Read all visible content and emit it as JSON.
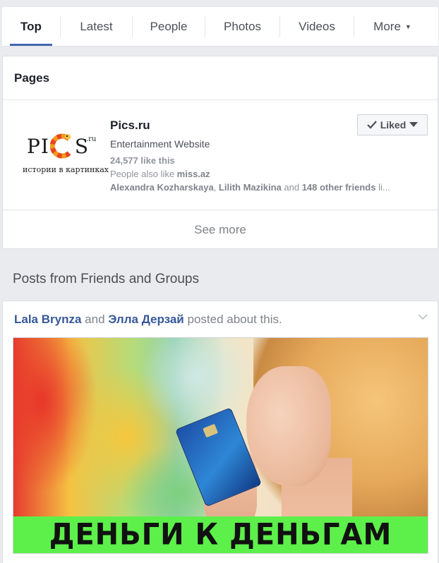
{
  "tabs": [
    {
      "label": "Top",
      "active": true
    },
    {
      "label": "Latest",
      "active": false
    },
    {
      "label": "People",
      "active": false
    },
    {
      "label": "Photos",
      "active": false
    },
    {
      "label": "Videos",
      "active": false
    },
    {
      "label": "More",
      "active": false
    }
  ],
  "pages_section": {
    "header": "Pages",
    "page": {
      "logo_text": "PICS",
      "logo_domain": ".ru",
      "logo_tagline": "истории в картинках",
      "name": "Pics.ru",
      "category": "Entertainment Website",
      "likes": "24,577 like this",
      "also_like_prefix": "People also like ",
      "also_like_page": "miss.az",
      "friend_1": "Alexandra Kozharskaya",
      "sep_1": ", ",
      "friend_2": "Lilith Mazikina",
      "sep_2": " and ",
      "friends_other": "148 other friends",
      "friends_suffix": " li...",
      "liked_button": "Liked"
    },
    "see_more": "See more"
  },
  "posts_section_title": "Posts from Friends and Groups",
  "post": {
    "actor_1": "Lala Brynza",
    "connector": " and ",
    "actor_2": "Элла Дерзай",
    "action": " posted about this.",
    "image_banner_text": "ДЕНЬГИ К ДЕНЬГАМ"
  },
  "colors": {
    "link": "#365899",
    "active_tab_underline": "#4267b2",
    "banner_green": "#5df04a"
  },
  "icons": [
    "chevron-down-icon",
    "checkmark-icon",
    "caret-down-icon"
  ]
}
